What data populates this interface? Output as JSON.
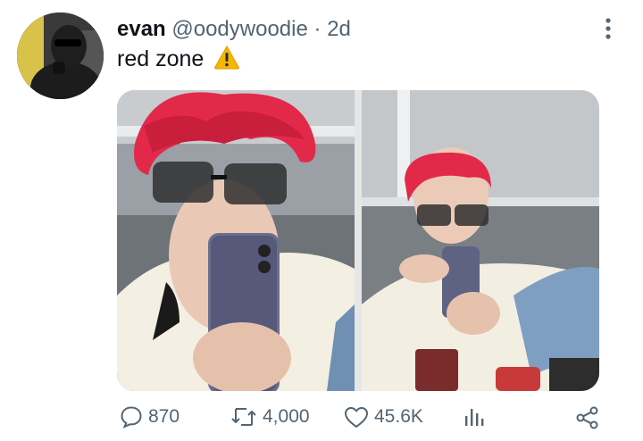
{
  "tweet": {
    "display_name": "evan",
    "handle": "@oodywoodie",
    "separator": "·",
    "time": "2d",
    "text": "red zone",
    "text_emoji": "warning-sign"
  },
  "media": {
    "photos": [
      {
        "name": "selfie-closeup"
      },
      {
        "name": "selfie-wide"
      }
    ]
  },
  "actions": {
    "reply_count": "870",
    "retweet_count": "4,000",
    "like_count": "45.6K"
  },
  "colors": {
    "secondary_text": "#536471",
    "hair_red": "#e3294a"
  }
}
